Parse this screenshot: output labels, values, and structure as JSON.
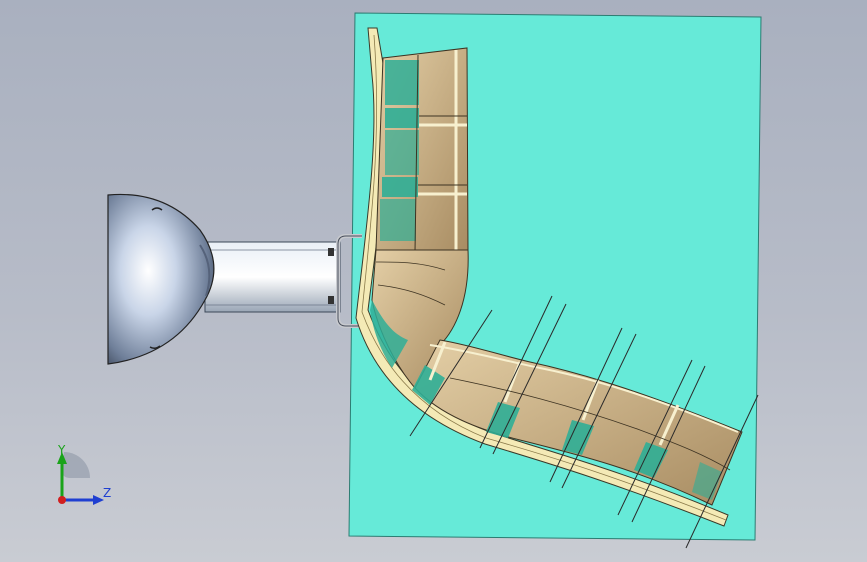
{
  "viewport": {
    "background_top": "#a9b0bf",
    "background_bottom": "#c9ccd3"
  },
  "model": {
    "plate_color": "#66ead8",
    "frame_color": "#f4eab6",
    "segment_color": "#c9ae82",
    "band_color": "#2fae96",
    "dome_color": "#c8d4e6"
  },
  "triad": {
    "y_label": "Y",
    "z_label": "Z",
    "y_color": "#1aa31a",
    "z_color": "#1f3fd1",
    "x_color": "#d11f1f"
  }
}
